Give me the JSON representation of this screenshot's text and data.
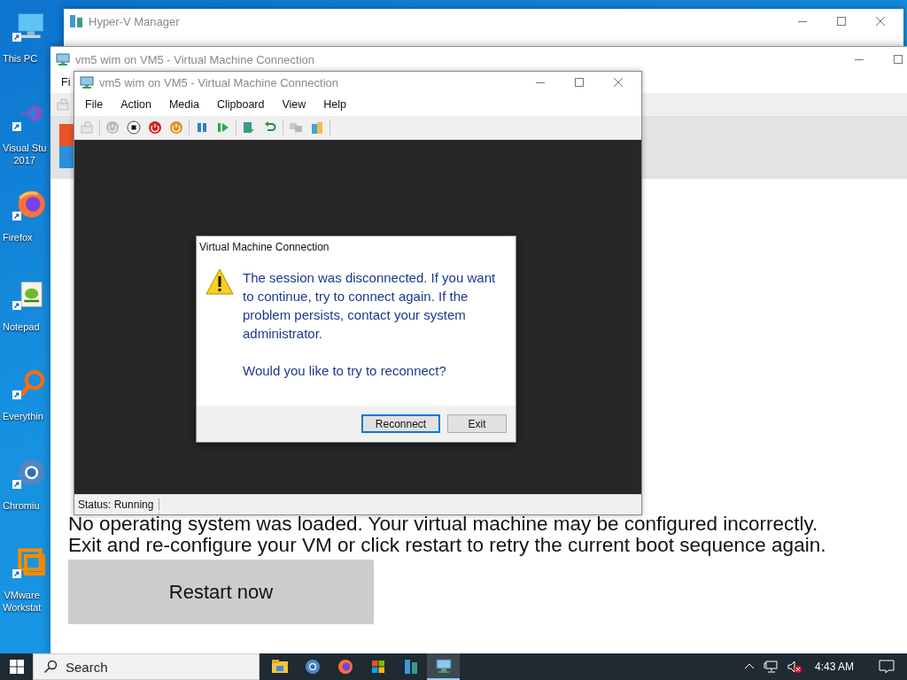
{
  "desktop_icons": [
    {
      "kind": "monitor",
      "lines": [
        "This PC"
      ]
    },
    {
      "kind": "loop",
      "lines": [
        "Visual Stu",
        "2017"
      ]
    },
    {
      "kind": "globe",
      "lines": [
        "Firefox"
      ]
    },
    {
      "kind": "notepad",
      "lines": [
        "Notepad"
      ]
    },
    {
      "kind": "magnifier",
      "lines": [
        "Everythin"
      ]
    },
    {
      "kind": "ring",
      "lines": [
        "Chromiu"
      ]
    },
    {
      "kind": "squares",
      "lines": [
        "VMware",
        "Workstat"
      ]
    }
  ],
  "manager_window": {
    "title": "Hyper-V Manager"
  },
  "back_window": {
    "title": "vm5 wim on VM5 - Virtual Machine Connection",
    "menu": [
      "Fi"
    ],
    "guest": {
      "message_lines": [
        "No operating system was loaded. Your virtual machine may be configured incorrectly.",
        "Exit and re-configure your VM or click restart to retry the current boot sequence again."
      ],
      "button": "Restart now"
    }
  },
  "front_window": {
    "title": "vm5 wim on VM5 - Virtual Machine Connection",
    "menu": [
      "File",
      "Action",
      "Media",
      "Clipboard",
      "View",
      "Help"
    ],
    "toolbar_groups": [
      {
        "buttons": [
          {
            "kind": "keyboard",
            "disabled": true
          }
        ]
      },
      {
        "buttons": [
          {
            "kind": "start",
            "disabled": true
          },
          {
            "kind": "turn_off",
            "disabled": false
          },
          {
            "kind": "shutdown",
            "disabled": false
          },
          {
            "kind": "save",
            "disabled": false
          }
        ]
      },
      {
        "buttons": [
          {
            "kind": "pause",
            "disabled": false
          },
          {
            "kind": "resume",
            "disabled": false
          }
        ]
      },
      {
        "buttons": [
          {
            "kind": "checkpoint",
            "disabled": false
          },
          {
            "kind": "revert",
            "disabled": false
          }
        ]
      },
      {
        "buttons": [
          {
            "kind": "enhanced",
            "disabled": true
          },
          {
            "kind": "share",
            "disabled": false
          }
        ]
      }
    ],
    "dialog": {
      "title": "Virtual Machine Connection",
      "message": "The session was disconnected. If you want to continue, try to connect again. If the problem persists, contact your system administrator.",
      "question": "Would you like to try to reconnect?",
      "buttons": [
        {
          "label": "Reconnect",
          "default": true
        },
        {
          "label": "Exit",
          "default": false
        }
      ]
    },
    "status": "Status: Running"
  },
  "taskbar": {
    "search": {
      "placeholder": "Search"
    },
    "apps": [
      {
        "kind": "folder",
        "selected": false
      },
      {
        "kind": "ring",
        "selected": false
      },
      {
        "kind": "globe",
        "selected": false
      },
      {
        "kind": "store",
        "selected": false
      },
      {
        "kind": "server",
        "selected": false
      },
      {
        "kind": "vm",
        "selected": true
      }
    ],
    "tray": {
      "volume_muted": true
    },
    "clock": "4:43 AM"
  }
}
